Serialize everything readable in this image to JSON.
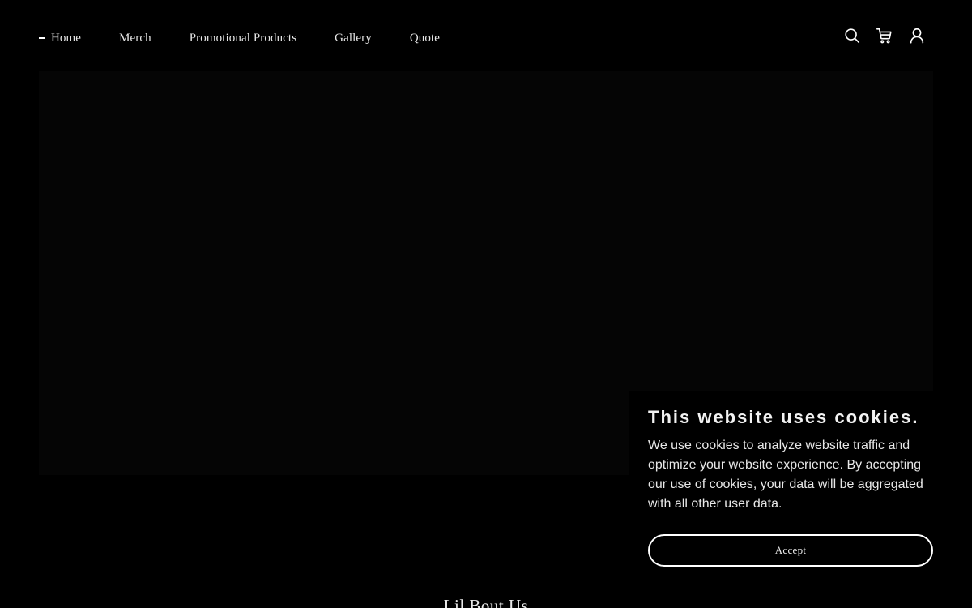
{
  "nav": {
    "items": [
      {
        "label": "Home",
        "active": true
      },
      {
        "label": "Merch",
        "active": false
      },
      {
        "label": "Promotional Products",
        "active": false
      },
      {
        "label": "Gallery",
        "active": false
      },
      {
        "label": "Quote",
        "active": false
      }
    ]
  },
  "header_icons": [
    "search-icon",
    "cart-icon",
    "account-icon"
  ],
  "about": {
    "title": "Lil Bout Us"
  },
  "cookie": {
    "title": "This website uses cookies.",
    "text": "We use cookies to analyze website traffic and optimize your website experience. By accepting our use of cookies, your data will be aggregated with all other user data.",
    "accept_label": "Accept"
  },
  "colors": {
    "background": "#000000",
    "hero": "#050505",
    "text": "#e8e8e8",
    "accent": "#ffffff"
  }
}
